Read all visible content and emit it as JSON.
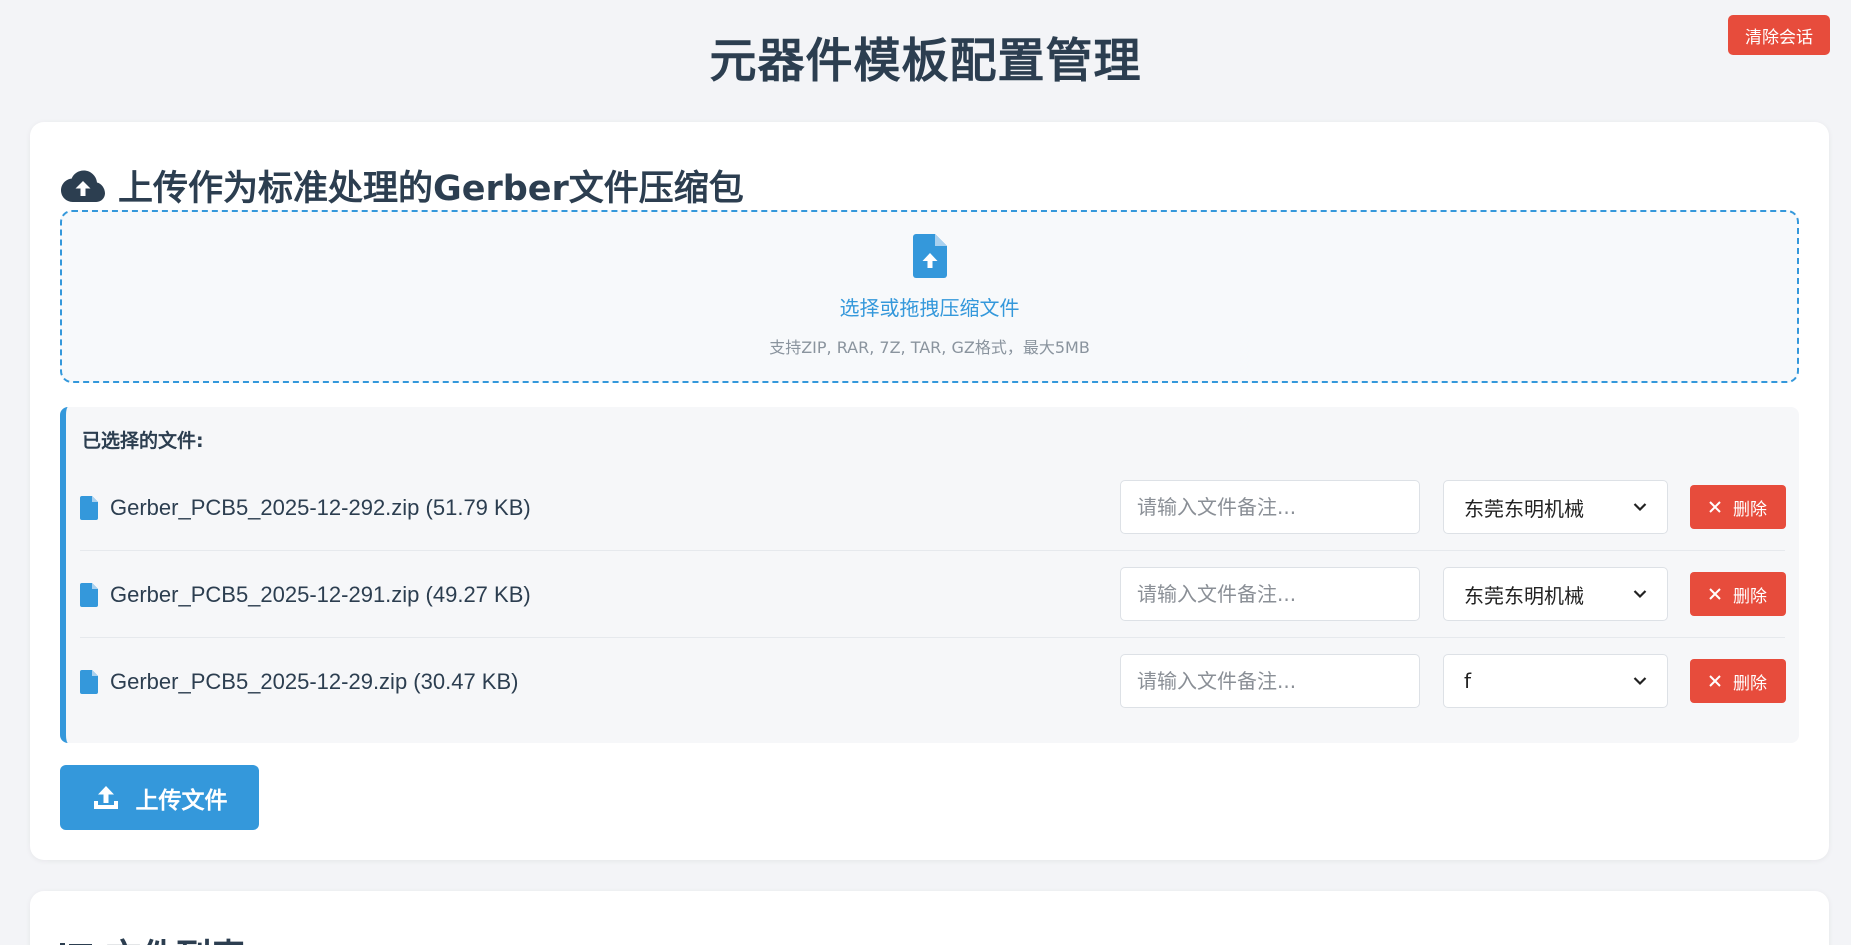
{
  "header": {
    "title": "元器件模板配置管理",
    "clear_session_label": "清除会话"
  },
  "upload_section": {
    "icon": "cloud-upload-icon",
    "title": "上传作为标准处理的Gerber文件压缩包",
    "dropzone": {
      "icon": "file-upload-icon",
      "main_text": "选择或拖拽压缩文件",
      "sub_text": "支持ZIP, RAR, 7Z, TAR, GZ格式，最大5MB"
    },
    "selected_title": "已选择的文件:",
    "files": [
      {
        "name": "Gerber_PCB5_2025-12-292.zip (51.79 KB)",
        "note_placeholder": "请输入文件备注...",
        "company": "东莞东明机械",
        "delete_label": "删除"
      },
      {
        "name": "Gerber_PCB5_2025-12-291.zip (49.27 KB)",
        "note_placeholder": "请输入文件备注...",
        "company": "东莞东明机械",
        "delete_label": "删除"
      },
      {
        "name": "Gerber_PCB5_2025-12-29.zip (30.47 KB)",
        "note_placeholder": "请输入文件备注...",
        "company": "f",
        "delete_label": "删除"
      }
    ],
    "upload_button_label": "上传文件"
  },
  "list_section": {
    "icon": "list-icon",
    "title": "文件列表"
  },
  "colors": {
    "primary": "#3498db",
    "danger": "#e74c3c",
    "text": "#2c3e50",
    "background": "#f3f4f7"
  }
}
